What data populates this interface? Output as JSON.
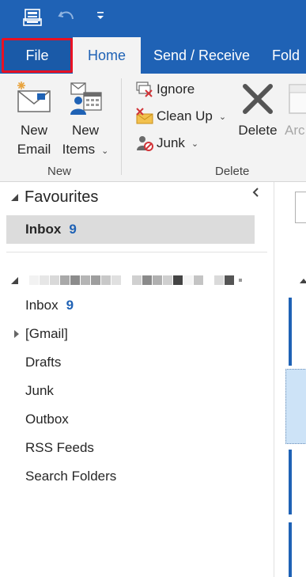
{
  "quick_access": {
    "icons": [
      "send-receive-all-folders-icon",
      "undo-icon",
      "customize-toolbar-icon"
    ]
  },
  "tabs": [
    {
      "label": "File"
    },
    {
      "label": "Home"
    },
    {
      "label": "Send / Receive"
    },
    {
      "label": "Fold"
    }
  ],
  "ribbon": {
    "new_group": {
      "new_email": {
        "line1": "New",
        "line2": "Email"
      },
      "new_items": {
        "line1": "New",
        "line2": "Items"
      },
      "label": "New"
    },
    "delete_group": {
      "ignore": "Ignore",
      "clean_up": "Clean Up",
      "junk": "Junk",
      "delete": "Delete",
      "archive": "Arc",
      "label": "Delete"
    }
  },
  "folder_pane": {
    "favourites_header": "Favourites",
    "favourites": [
      {
        "name": "Inbox",
        "count": "9"
      }
    ],
    "folders": [
      {
        "name": "Inbox",
        "count": "9"
      },
      {
        "name": "[Gmail]",
        "count": ""
      },
      {
        "name": "Drafts",
        "count": ""
      },
      {
        "name": "Junk",
        "count": ""
      },
      {
        "name": "Outbox",
        "count": ""
      },
      {
        "name": "RSS Feeds",
        "count": ""
      },
      {
        "name": "Search Folders",
        "count": ""
      }
    ]
  },
  "colors": {
    "accent": "#1f62b5",
    "ribbon_bg": "#f3f3f3",
    "highlight_border": "#e81123",
    "selection": "#cde3f7"
  }
}
